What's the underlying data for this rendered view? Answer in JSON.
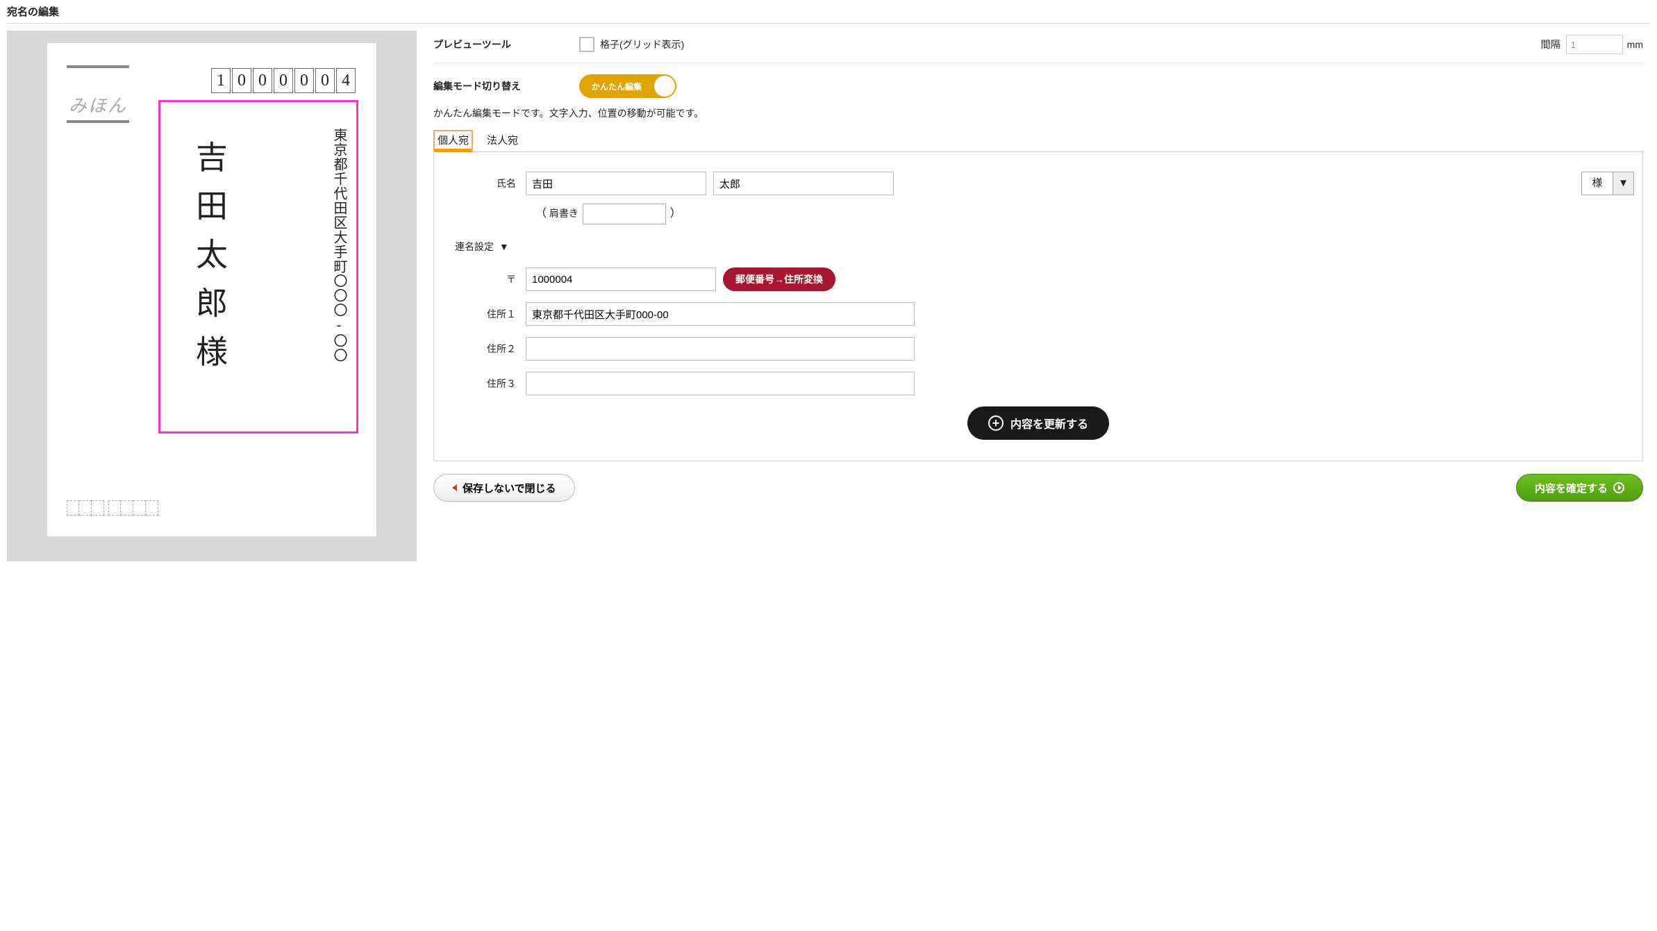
{
  "page": {
    "title": "宛名の編集"
  },
  "preview": {
    "sample_label": "みほん",
    "zip_digits": [
      "1",
      "0",
      "0",
      "0",
      "0",
      "0",
      "4"
    ],
    "address_vertical": "東京都千代田区大手町〇〇〇‐〇〇",
    "name_vertical": "吉田太郎様"
  },
  "tools": {
    "header": "プレビューツール",
    "grid_label": "格子(グリッド表示)",
    "gap_label": "間隔",
    "gap_value": "1",
    "gap_unit": "mm"
  },
  "mode": {
    "header": "編集モード切り替え",
    "toggle_label": "かんたん編集",
    "description": "かんたん編集モードです。文字入力、位置の移動が可能です。"
  },
  "tabs": {
    "personal": "個人宛",
    "corporate": "法人宛"
  },
  "form": {
    "labels": {
      "name": "氏名",
      "katagaki": "肩書き",
      "renmei": "連名設定",
      "zip_mark": "〒",
      "addr1": "住所１",
      "addr2": "住所２",
      "addr3": "住所３"
    },
    "values": {
      "surname": "吉田",
      "given": "太郎",
      "honorific": "様",
      "katagaki": "",
      "zip": "1000004",
      "addr1": "東京都千代田区大手町000-00",
      "addr2": "",
      "addr3": ""
    },
    "buttons": {
      "zip_lookup": "郵便番号→住所変換",
      "update": "内容を更新する"
    }
  },
  "footer": {
    "close_without_save": "保存しないで閉じる",
    "confirm": "内容を確定する"
  }
}
